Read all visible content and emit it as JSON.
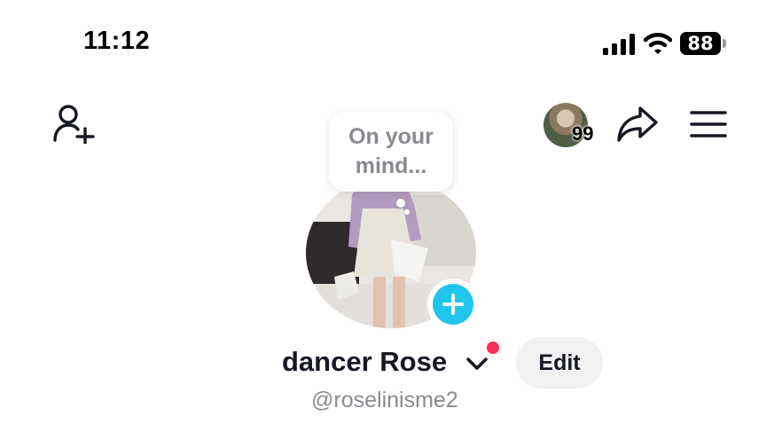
{
  "status_bar": {
    "time": "11:12",
    "battery_level": "88",
    "signal_icon": "cellular-signal-icon",
    "wifi_icon": "wifi-icon"
  },
  "nav": {
    "add_friend_icon": "add-friend-icon",
    "notifications_count": "99",
    "share_icon": "share-icon",
    "menu_icon": "hamburger-menu-icon"
  },
  "profile": {
    "note_placeholder": "On your mind...",
    "display_name": "dancer Rose",
    "username": "@roselinisme2",
    "edit_label": "Edit",
    "add_story_icon": "plus-icon"
  },
  "colors": {
    "accent_cyan": "#20c5ee",
    "notification_red": "#fe2c55",
    "secondary_text": "#8a8b91",
    "edit_button_bg": "#f1f1f2"
  }
}
